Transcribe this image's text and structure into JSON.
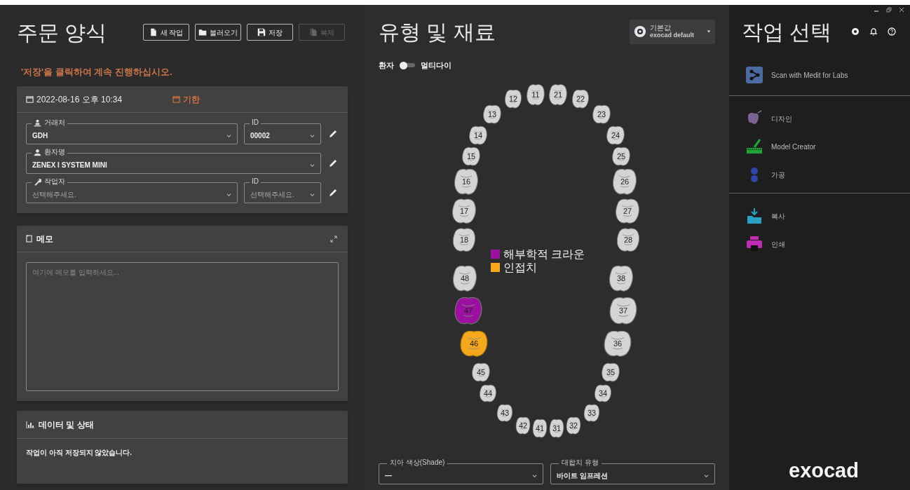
{
  "order_form": {
    "title": "주문 양식",
    "buttons": [
      {
        "label": "새 작업",
        "disabled": false
      },
      {
        "label": "불러오기",
        "disabled": false
      },
      {
        "label": "저장",
        "disabled": false
      },
      {
        "label": "복제",
        "disabled": true
      }
    ],
    "notice": "'저장'을 클릭하여 계속 진행하십시오.",
    "date": "2022-08-16 오후 10:34",
    "deadline": "기한",
    "rows": [
      {
        "field": {
          "label": "거래처",
          "value": "GDH"
        },
        "id_field": {
          "label": "ID",
          "value": "00002"
        }
      },
      {
        "field": {
          "label": "환자명",
          "value": "ZENEX I SYSTEM MINI"
        }
      },
      {
        "field": {
          "label": "작업자",
          "placeholder": "선택해주세요."
        },
        "id_field": {
          "label": "ID",
          "placeholder": "선택해주세요."
        }
      }
    ],
    "memo": {
      "title": "메모",
      "placeholder": "여기에 메모를 입력하세요..."
    },
    "data_status": {
      "title": "데이터 및 상태",
      "message": "작업이 아직 저장되지 않았습니다."
    }
  },
  "type_material": {
    "title": "유형 및 재료",
    "preset": {
      "label": "기본값",
      "value": "exocad default"
    },
    "toggle": {
      "left": "환자",
      "right": "멀티다이",
      "on": false
    },
    "teeth": [
      {
        "number": "11",
        "crown": false,
        "adjacent": false
      },
      {
        "number": "21",
        "crown": false,
        "adjacent": false
      },
      {
        "number": "12",
        "crown": false,
        "adjacent": false
      },
      {
        "number": "22",
        "crown": false,
        "adjacent": false
      },
      {
        "number": "13",
        "crown": false,
        "adjacent": false
      },
      {
        "number": "23",
        "crown": false,
        "adjacent": false
      },
      {
        "number": "14",
        "crown": false,
        "adjacent": false
      },
      {
        "number": "24",
        "crown": false,
        "adjacent": false
      },
      {
        "number": "15",
        "crown": false,
        "adjacent": false
      },
      {
        "number": "25",
        "crown": false,
        "adjacent": false
      },
      {
        "number": "16",
        "crown": false,
        "adjacent": false
      },
      {
        "number": "26",
        "crown": false,
        "adjacent": false
      },
      {
        "number": "17",
        "crown": false,
        "adjacent": false
      },
      {
        "number": "27",
        "crown": false,
        "adjacent": false
      },
      {
        "number": "18",
        "crown": false,
        "adjacent": false
      },
      {
        "number": "28",
        "crown": false,
        "adjacent": false
      },
      {
        "number": "48",
        "crown": false,
        "adjacent": false
      },
      {
        "number": "38",
        "crown": false,
        "adjacent": false
      },
      {
        "number": "47",
        "crown": true,
        "adjacent": false
      },
      {
        "number": "37",
        "crown": false,
        "adjacent": false
      },
      {
        "number": "46",
        "crown": false,
        "adjacent": true
      },
      {
        "number": "36",
        "crown": false,
        "adjacent": false
      },
      {
        "number": "45",
        "crown": false,
        "adjacent": false
      },
      {
        "number": "35",
        "crown": false,
        "adjacent": false
      },
      {
        "number": "44",
        "crown": false,
        "adjacent": false
      },
      {
        "number": "34",
        "crown": false,
        "adjacent": false
      },
      {
        "number": "43",
        "crown": false,
        "adjacent": false
      },
      {
        "number": "33",
        "crown": false,
        "adjacent": false
      },
      {
        "number": "42",
        "crown": false,
        "adjacent": false
      },
      {
        "number": "32",
        "crown": false,
        "adjacent": false
      },
      {
        "number": "41",
        "crown": false,
        "adjacent": false
      },
      {
        "number": "31",
        "crown": false,
        "adjacent": false
      }
    ],
    "legend": [
      {
        "label": "해부학적 크라운",
        "color": "#9c109f"
      },
      {
        "label": "인접치",
        "color": "#f5a81c"
      }
    ],
    "shade": {
      "label": "치아 색상(Shade)",
      "value": "—"
    },
    "antagonist": {
      "label": "대합치 유형",
      "value": "바이트 임프레션"
    }
  },
  "task_select": {
    "title": "작업 선택",
    "groups": [
      [
        {
          "label": "Scan with Medit for Labs"
        }
      ],
      [
        {
          "label": "디자인"
        },
        {
          "label": "Model Creator"
        },
        {
          "label": "가공"
        }
      ],
      [
        {
          "label": "복사"
        },
        {
          "label": "인쇄"
        }
      ]
    ],
    "logo": "exocad"
  }
}
